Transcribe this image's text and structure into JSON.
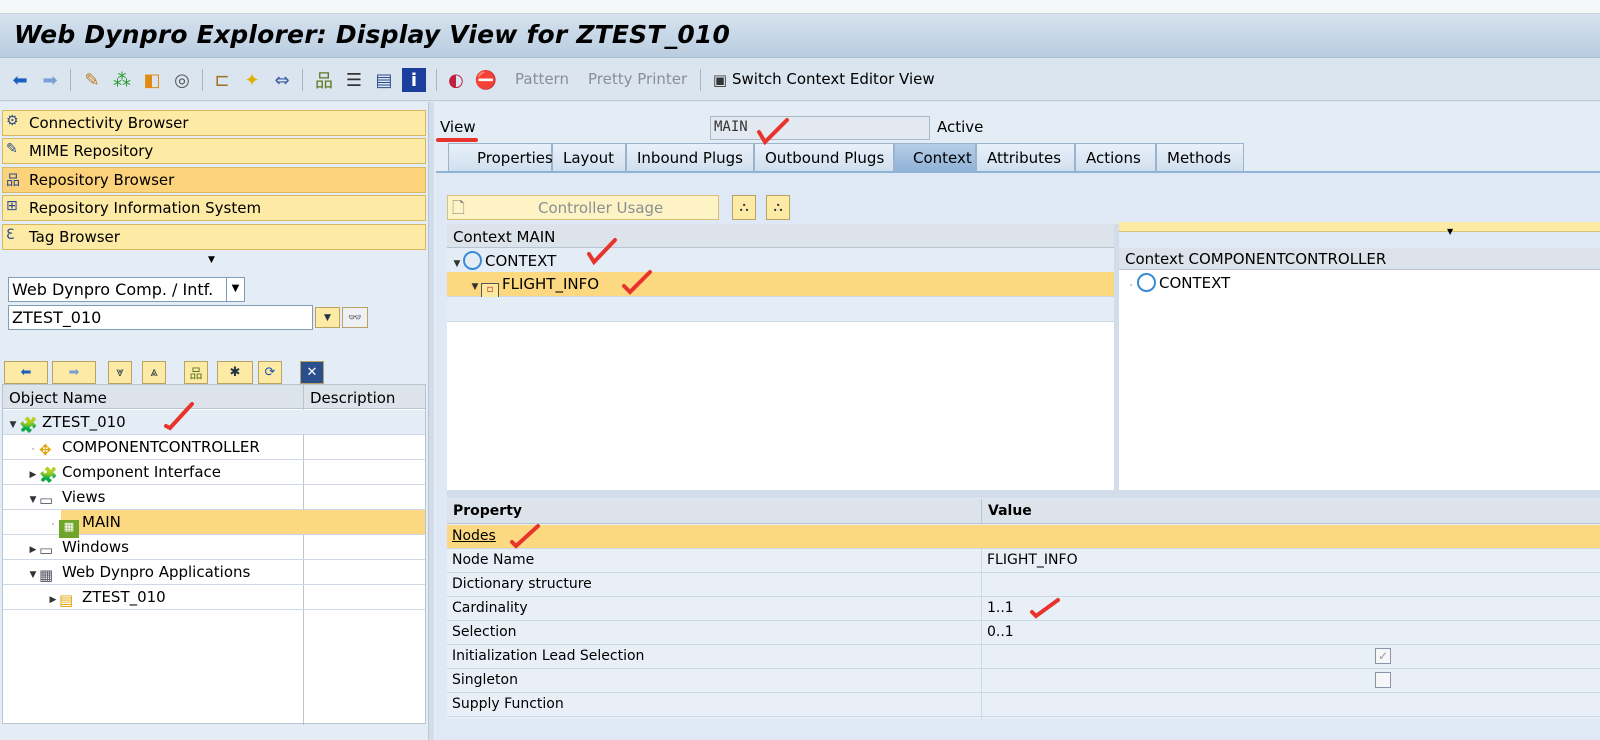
{
  "window": {
    "title": "Web Dynpro Explorer: Display View for ZTEST_010"
  },
  "toolbar": {
    "pattern": "Pattern",
    "pretty_printer": "Pretty Printer",
    "switch_context": "Switch Context Editor View"
  },
  "left": {
    "nav_buttons": [
      "Connectivity Browser",
      "MIME Repository",
      "Repository Browser",
      "Repository Information System",
      "Tag Browser"
    ],
    "object_type": "Web Dynpro Comp. / Intf.",
    "object_name": "ZTEST_010",
    "tree": {
      "col_name": "Object Name",
      "col_desc": "Description",
      "rows": [
        {
          "label": "ZTEST_010",
          "level": 0,
          "expander": "open"
        },
        {
          "label": "COMPONENTCONTROLLER",
          "level": 1,
          "expander": "leaf"
        },
        {
          "label": "Component Interface",
          "level": 1,
          "expander": "closed"
        },
        {
          "label": "Views",
          "level": 1,
          "expander": "open"
        },
        {
          "label": "MAIN",
          "level": 2,
          "expander": "leaf",
          "selected": true
        },
        {
          "label": "Windows",
          "level": 1,
          "expander": "closed"
        },
        {
          "label": "Web Dynpro Applications",
          "level": 1,
          "expander": "open"
        },
        {
          "label": "ZTEST_010",
          "level": 2,
          "expander": "closed"
        }
      ]
    }
  },
  "view": {
    "label": "View",
    "name": "MAIN",
    "status": "Active",
    "tabs": [
      "Properties",
      "Layout",
      "Inbound Plugs",
      "Outbound Plugs",
      "Context",
      "Attributes",
      "Actions",
      "Methods"
    ],
    "active_tab": "Context"
  },
  "context": {
    "controller_usage": "Controller Usage",
    "main_header": "Context MAIN",
    "main_root": "CONTEXT",
    "main_node": "FLIGHT_INFO",
    "comp_header": "Context COMPONENTCONTROLLER",
    "comp_root": "CONTEXT"
  },
  "properties": {
    "col_property": "Property",
    "col_value": "Value",
    "section": "Nodes",
    "rows": [
      {
        "name": "Node Name",
        "value": "FLIGHT_INFO"
      },
      {
        "name": "Dictionary structure",
        "value": ""
      },
      {
        "name": "Cardinality",
        "value": "1..1"
      },
      {
        "name": "Selection",
        "value": "0..1"
      },
      {
        "name": "Initialization Lead Selection",
        "value": "",
        "checkbox": true,
        "checked": true
      },
      {
        "name": "Singleton",
        "value": "",
        "checkbox": true,
        "checked": false
      },
      {
        "name": "Supply Function",
        "value": ""
      }
    ]
  },
  "colors": {
    "selected_row": "#fcd980",
    "nav_button": "#fdeaa4",
    "annotation": "#e8342c"
  }
}
